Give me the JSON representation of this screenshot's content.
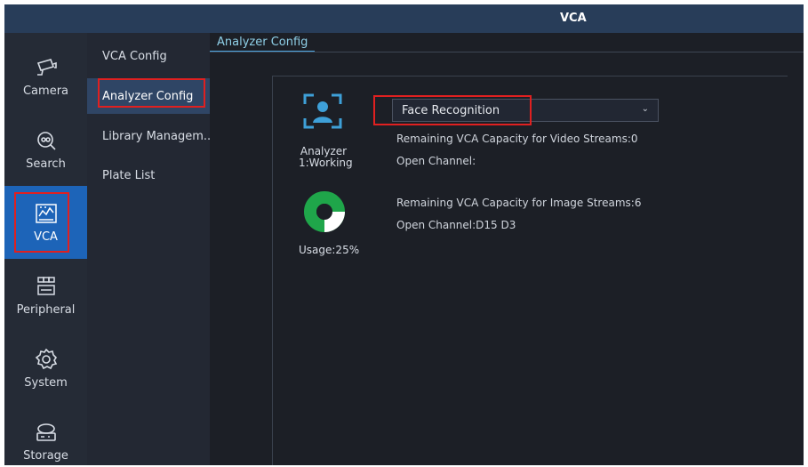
{
  "window": {
    "title": "VCA"
  },
  "nav": {
    "items": [
      {
        "label": "Camera",
        "icon": "camera-icon"
      },
      {
        "label": "Search",
        "icon": "search-icon"
      },
      {
        "label": "VCA",
        "icon": "vca-icon",
        "active": true
      },
      {
        "label": "Peripheral",
        "icon": "peripheral-icon"
      },
      {
        "label": "System",
        "icon": "gear-icon"
      },
      {
        "label": "Storage",
        "icon": "storage-icon"
      }
    ]
  },
  "subnav": {
    "items": [
      {
        "label": "VCA Config"
      },
      {
        "label": "Analyzer Config",
        "active": true
      },
      {
        "label": "Library Managem..."
      },
      {
        "label": "Plate List"
      }
    ]
  },
  "tab": {
    "label": "Analyzer Config"
  },
  "analyzer": {
    "name": "Analyzer",
    "status": "1:Working",
    "usage_label": "Usage:25%",
    "usage_value": 0.25,
    "mode": "Face Recognition",
    "video_capacity": "Remaining VCA Capacity for Video Streams:0",
    "video_channel": "Open Channel:",
    "image_capacity": "Remaining VCA Capacity for Image Streams:6",
    "image_channel": "Open Channel:D15 D3"
  },
  "colors": {
    "accent": "#1d64b8",
    "titlebar": "#283d59",
    "highlight": "#e02020",
    "usage": "#1fa64a"
  }
}
